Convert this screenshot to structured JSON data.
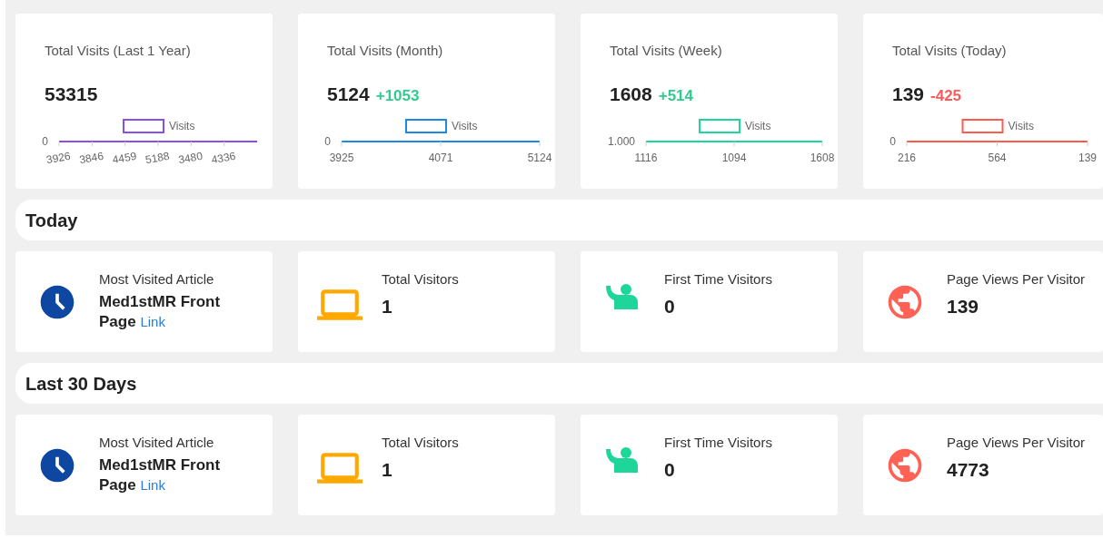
{
  "stat_cards": [
    {
      "title": "Total Visits (Last 1 Year)",
      "value": "53315",
      "color": "#8a4fe6",
      "chart": {
        "legend": "Visits",
        "y_tick": "0",
        "x_labels": [
          "3926",
          "3846",
          "4459",
          "5188",
          "3480",
          "4336"
        ]
      }
    },
    {
      "title": "Total Visits (Month)",
      "value": "5124",
      "delta": {
        "text": "+1053",
        "color": "#2ecc8f"
      },
      "color": "#1e88e5",
      "chart": {
        "legend": "Visits",
        "y_tick": "0",
        "x_labels": [
          "3925",
          "4071",
          "5124"
        ]
      }
    },
    {
      "title": "Total Visits (Week)",
      "value": "1608",
      "delta": {
        "text": "+514",
        "color": "#2ecc8f"
      },
      "color": "#1ed69a",
      "chart": {
        "legend": "Visits",
        "y_tick": "1.000",
        "x_labels": [
          "1116",
          "1094",
          "1608"
        ]
      }
    },
    {
      "title": "Total Visits (Today)",
      "value": "139",
      "delta": {
        "text": "-425",
        "color": "#ff5a5a"
      },
      "color": "#ff5a4e",
      "chart": {
        "legend": "Visits",
        "y_tick": "0",
        "x_labels": [
          "216",
          "564",
          "139"
        ]
      }
    }
  ],
  "sections": [
    {
      "title": "Today",
      "items": [
        {
          "kind": "article",
          "label": "Most Visited Article",
          "value": "Med1stMR Front Page",
          "link": "Link",
          "color": "#0d47a1"
        },
        {
          "kind": "visitors",
          "label": "Total Visitors",
          "value": "1",
          "color": "#ffa800"
        },
        {
          "kind": "first_time",
          "label": "First Time Visitors",
          "value": "0",
          "color": "#1ed69a"
        },
        {
          "kind": "page_views",
          "label": "Page Views Per Visitor",
          "value": "139",
          "color": "#ff6155"
        }
      ]
    },
    {
      "title": "Last 30 Days",
      "items": [
        {
          "kind": "article",
          "label": "Most Visited Article",
          "value": "Med1stMR Front Page",
          "link": "Link",
          "color": "#0d47a1"
        },
        {
          "kind": "visitors",
          "label": "Total Visitors",
          "value": "1",
          "color": "#ffa800"
        },
        {
          "kind": "first_time",
          "label": "First Time Visitors",
          "value": "0",
          "color": "#1ed69a"
        },
        {
          "kind": "page_views",
          "label": "Page Views Per Visitor",
          "value": "4773",
          "color": "#ff6155"
        }
      ]
    }
  ]
}
